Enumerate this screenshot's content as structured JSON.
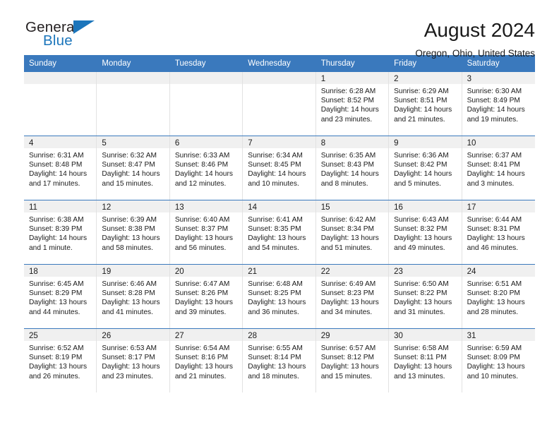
{
  "brand": {
    "name_top": "General",
    "name_bottom": "Blue",
    "accent_color": "#1b75bb",
    "text_color": "#231f20"
  },
  "header": {
    "title": "August 2024",
    "subtitle": "Oregon, Ohio, United States",
    "header_bg": "#3a79bd",
    "daynum_bg": "#f0f0f0"
  },
  "weekdays": [
    "Sunday",
    "Monday",
    "Tuesday",
    "Wednesday",
    "Thursday",
    "Friday",
    "Saturday"
  ],
  "weeks": [
    [
      {
        "day": "",
        "sunrise": "",
        "sunset": "",
        "daylight1": "",
        "daylight2": ""
      },
      {
        "day": "",
        "sunrise": "",
        "sunset": "",
        "daylight1": "",
        "daylight2": ""
      },
      {
        "day": "",
        "sunrise": "",
        "sunset": "",
        "daylight1": "",
        "daylight2": ""
      },
      {
        "day": "",
        "sunrise": "",
        "sunset": "",
        "daylight1": "",
        "daylight2": ""
      },
      {
        "day": "1",
        "sunrise": "Sunrise: 6:28 AM",
        "sunset": "Sunset: 8:52 PM",
        "daylight1": "Daylight: 14 hours",
        "daylight2": "and 23 minutes."
      },
      {
        "day": "2",
        "sunrise": "Sunrise: 6:29 AM",
        "sunset": "Sunset: 8:51 PM",
        "daylight1": "Daylight: 14 hours",
        "daylight2": "and 21 minutes."
      },
      {
        "day": "3",
        "sunrise": "Sunrise: 6:30 AM",
        "sunset": "Sunset: 8:49 PM",
        "daylight1": "Daylight: 14 hours",
        "daylight2": "and 19 minutes."
      }
    ],
    [
      {
        "day": "4",
        "sunrise": "Sunrise: 6:31 AM",
        "sunset": "Sunset: 8:48 PM",
        "daylight1": "Daylight: 14 hours",
        "daylight2": "and 17 minutes."
      },
      {
        "day": "5",
        "sunrise": "Sunrise: 6:32 AM",
        "sunset": "Sunset: 8:47 PM",
        "daylight1": "Daylight: 14 hours",
        "daylight2": "and 15 minutes."
      },
      {
        "day": "6",
        "sunrise": "Sunrise: 6:33 AM",
        "sunset": "Sunset: 8:46 PM",
        "daylight1": "Daylight: 14 hours",
        "daylight2": "and 12 minutes."
      },
      {
        "day": "7",
        "sunrise": "Sunrise: 6:34 AM",
        "sunset": "Sunset: 8:45 PM",
        "daylight1": "Daylight: 14 hours",
        "daylight2": "and 10 minutes."
      },
      {
        "day": "8",
        "sunrise": "Sunrise: 6:35 AM",
        "sunset": "Sunset: 8:43 PM",
        "daylight1": "Daylight: 14 hours",
        "daylight2": "and 8 minutes."
      },
      {
        "day": "9",
        "sunrise": "Sunrise: 6:36 AM",
        "sunset": "Sunset: 8:42 PM",
        "daylight1": "Daylight: 14 hours",
        "daylight2": "and 5 minutes."
      },
      {
        "day": "10",
        "sunrise": "Sunrise: 6:37 AM",
        "sunset": "Sunset: 8:41 PM",
        "daylight1": "Daylight: 14 hours",
        "daylight2": "and 3 minutes."
      }
    ],
    [
      {
        "day": "11",
        "sunrise": "Sunrise: 6:38 AM",
        "sunset": "Sunset: 8:39 PM",
        "daylight1": "Daylight: 14 hours",
        "daylight2": "and 1 minute."
      },
      {
        "day": "12",
        "sunrise": "Sunrise: 6:39 AM",
        "sunset": "Sunset: 8:38 PM",
        "daylight1": "Daylight: 13 hours",
        "daylight2": "and 58 minutes."
      },
      {
        "day": "13",
        "sunrise": "Sunrise: 6:40 AM",
        "sunset": "Sunset: 8:37 PM",
        "daylight1": "Daylight: 13 hours",
        "daylight2": "and 56 minutes."
      },
      {
        "day": "14",
        "sunrise": "Sunrise: 6:41 AM",
        "sunset": "Sunset: 8:35 PM",
        "daylight1": "Daylight: 13 hours",
        "daylight2": "and 54 minutes."
      },
      {
        "day": "15",
        "sunrise": "Sunrise: 6:42 AM",
        "sunset": "Sunset: 8:34 PM",
        "daylight1": "Daylight: 13 hours",
        "daylight2": "and 51 minutes."
      },
      {
        "day": "16",
        "sunrise": "Sunrise: 6:43 AM",
        "sunset": "Sunset: 8:32 PM",
        "daylight1": "Daylight: 13 hours",
        "daylight2": "and 49 minutes."
      },
      {
        "day": "17",
        "sunrise": "Sunrise: 6:44 AM",
        "sunset": "Sunset: 8:31 PM",
        "daylight1": "Daylight: 13 hours",
        "daylight2": "and 46 minutes."
      }
    ],
    [
      {
        "day": "18",
        "sunrise": "Sunrise: 6:45 AM",
        "sunset": "Sunset: 8:29 PM",
        "daylight1": "Daylight: 13 hours",
        "daylight2": "and 44 minutes."
      },
      {
        "day": "19",
        "sunrise": "Sunrise: 6:46 AM",
        "sunset": "Sunset: 8:28 PM",
        "daylight1": "Daylight: 13 hours",
        "daylight2": "and 41 minutes."
      },
      {
        "day": "20",
        "sunrise": "Sunrise: 6:47 AM",
        "sunset": "Sunset: 8:26 PM",
        "daylight1": "Daylight: 13 hours",
        "daylight2": "and 39 minutes."
      },
      {
        "day": "21",
        "sunrise": "Sunrise: 6:48 AM",
        "sunset": "Sunset: 8:25 PM",
        "daylight1": "Daylight: 13 hours",
        "daylight2": "and 36 minutes."
      },
      {
        "day": "22",
        "sunrise": "Sunrise: 6:49 AM",
        "sunset": "Sunset: 8:23 PM",
        "daylight1": "Daylight: 13 hours",
        "daylight2": "and 34 minutes."
      },
      {
        "day": "23",
        "sunrise": "Sunrise: 6:50 AM",
        "sunset": "Sunset: 8:22 PM",
        "daylight1": "Daylight: 13 hours",
        "daylight2": "and 31 minutes."
      },
      {
        "day": "24",
        "sunrise": "Sunrise: 6:51 AM",
        "sunset": "Sunset: 8:20 PM",
        "daylight1": "Daylight: 13 hours",
        "daylight2": "and 28 minutes."
      }
    ],
    [
      {
        "day": "25",
        "sunrise": "Sunrise: 6:52 AM",
        "sunset": "Sunset: 8:19 PM",
        "daylight1": "Daylight: 13 hours",
        "daylight2": "and 26 minutes."
      },
      {
        "day": "26",
        "sunrise": "Sunrise: 6:53 AM",
        "sunset": "Sunset: 8:17 PM",
        "daylight1": "Daylight: 13 hours",
        "daylight2": "and 23 minutes."
      },
      {
        "day": "27",
        "sunrise": "Sunrise: 6:54 AM",
        "sunset": "Sunset: 8:16 PM",
        "daylight1": "Daylight: 13 hours",
        "daylight2": "and 21 minutes."
      },
      {
        "day": "28",
        "sunrise": "Sunrise: 6:55 AM",
        "sunset": "Sunset: 8:14 PM",
        "daylight1": "Daylight: 13 hours",
        "daylight2": "and 18 minutes."
      },
      {
        "day": "29",
        "sunrise": "Sunrise: 6:57 AM",
        "sunset": "Sunset: 8:12 PM",
        "daylight1": "Daylight: 13 hours",
        "daylight2": "and 15 minutes."
      },
      {
        "day": "30",
        "sunrise": "Sunrise: 6:58 AM",
        "sunset": "Sunset: 8:11 PM",
        "daylight1": "Daylight: 13 hours",
        "daylight2": "and 13 minutes."
      },
      {
        "day": "31",
        "sunrise": "Sunrise: 6:59 AM",
        "sunset": "Sunset: 8:09 PM",
        "daylight1": "Daylight: 13 hours",
        "daylight2": "and 10 minutes."
      }
    ]
  ]
}
